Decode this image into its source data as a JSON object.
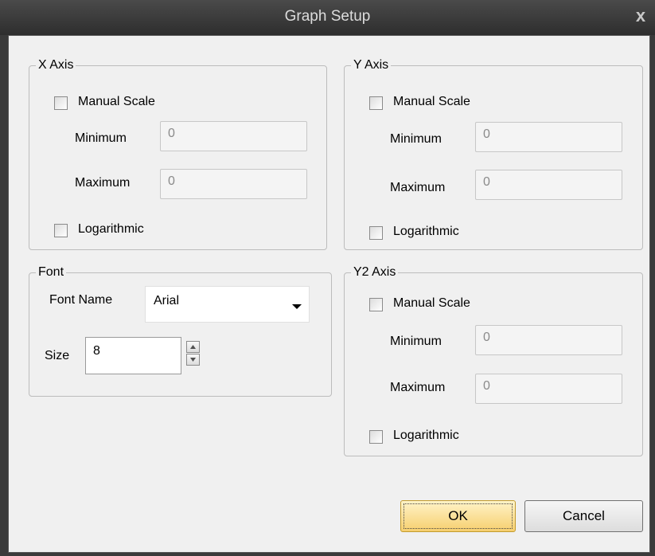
{
  "window": {
    "title": "Graph Setup",
    "close_symbol": "x"
  },
  "x_axis": {
    "title": "X Axis",
    "manual_scale": "Manual Scale",
    "minimum_label": "Minimum",
    "minimum_value": "0",
    "maximum_label": "Maximum",
    "maximum_value": "0",
    "logarithmic": "Logarithmic"
  },
  "y_axis": {
    "title": "Y Axis",
    "manual_scale": "Manual Scale",
    "minimum_label": "Minimum",
    "minimum_value": "0",
    "maximum_label": "Maximum",
    "maximum_value": "0",
    "logarithmic": "Logarithmic"
  },
  "y2_axis": {
    "title": "Y2 Axis",
    "manual_scale": "Manual Scale",
    "minimum_label": "Minimum",
    "minimum_value": "0",
    "maximum_label": "Maximum",
    "maximum_value": "0",
    "logarithmic": "Logarithmic"
  },
  "font": {
    "title": "Font",
    "font_name_label": "Font Name",
    "font_name_value": "Arial",
    "size_label": "Size",
    "size_value": "8"
  },
  "buttons": {
    "ok": "OK",
    "cancel": "Cancel"
  }
}
